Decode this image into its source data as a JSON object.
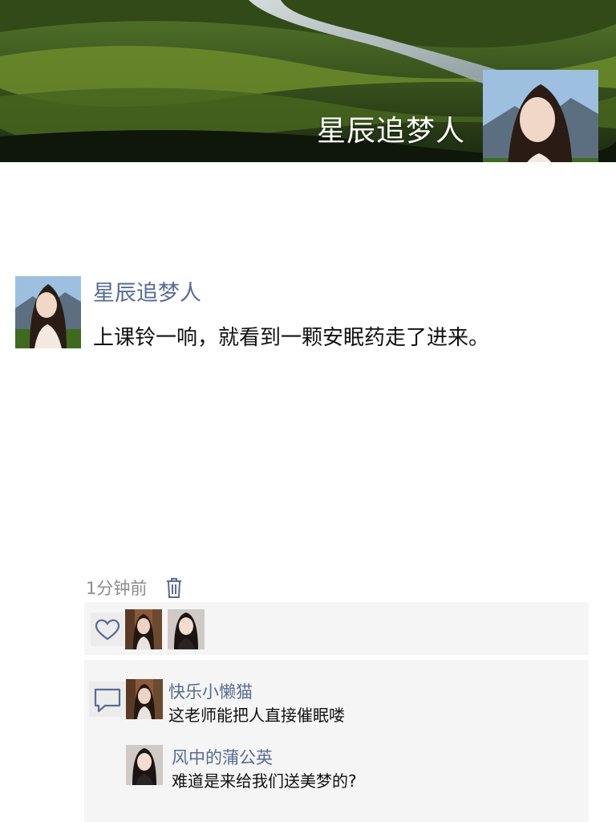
{
  "cover": {
    "username": "星辰追梦人",
    "colors": {
      "sky": "#9dc0e0",
      "grass": "#3e6a1a",
      "river": "#d9dee2"
    }
  },
  "post": {
    "author": "星辰追梦人",
    "text": "上课铃一响，就看到一颗安眠药走了进来。",
    "time": "1分钟前",
    "delete_icon": "trash-icon"
  },
  "likes": {
    "icon": "heart-icon",
    "users": [
      "user-1-avatar",
      "user-2-avatar"
    ]
  },
  "comments": {
    "icon": "comment-bubble-icon",
    "items": [
      {
        "user": "快乐小懒猫",
        "text": "这老师能把人直接催眠喽"
      },
      {
        "user": "风中的蒲公英",
        "text": "难道是来给我们送美梦的?"
      }
    ]
  },
  "colors": {
    "link": "#576b95",
    "muted": "#8c8c8c",
    "panel": "#f5f5f5"
  }
}
